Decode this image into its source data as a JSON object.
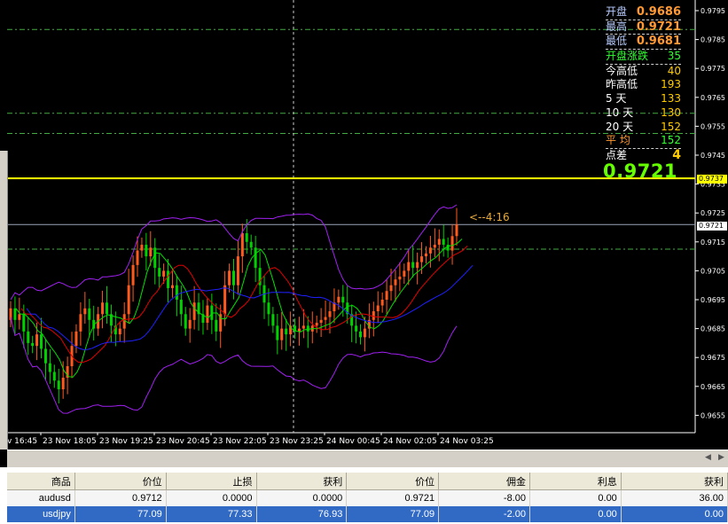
{
  "chart": {
    "price_axis": [
      "0.9795",
      "0.9785",
      "0.9775",
      "0.9765",
      "0.9755",
      "0.9745",
      "0.9735",
      "0.9725",
      "0.9715",
      "0.9705",
      "0.9695",
      "0.9685",
      "0.9675",
      "0.9665",
      "0.9655"
    ],
    "time_axis": [
      "23 Nov 16:45",
      "23 Nov 18:05",
      "23 Nov 19:25",
      "23 Nov 20:45",
      "23 Nov 22:05",
      "23 Nov 23:25",
      "24 Nov 00:45",
      "24 Nov 02:05",
      "24 Nov 03:25"
    ],
    "time_axis_first_visible": "v 16:45",
    "yellow_line_price": "0.9737",
    "current_price_tag": "0.9721",
    "countdown": "<--4:16",
    "big_price": "0.9721",
    "colors": {
      "up_candle": "#ff5a1e",
      "down_candle": "#00d200",
      "bollinger": "#a020f0",
      "ma_green": "#00e000",
      "ma_red": "#e00000",
      "ma_blue": "#2020ff",
      "grid_green": "#44aa44",
      "yellow": "#ffff00"
    }
  },
  "info_panel": [
    {
      "label": "开盘",
      "value": "0.9686",
      "label_color": "#b8ccff",
      "value_color": "#ff9933",
      "dashed": true
    },
    {
      "label": "最高",
      "value": "0.9721",
      "label_color": "#b8ccff",
      "value_color": "#ff9933",
      "dashed": true
    },
    {
      "label": "最低",
      "value": "0.9681",
      "label_color": "#b8ccff",
      "value_color": "#ff9933",
      "dashed": true
    },
    {
      "label": "开盘涨跌",
      "value": "35",
      "label_color": "#33ff33",
      "value_color": "#33ff33",
      "dashed": true
    },
    {
      "label": "今高低",
      "value": "40",
      "label_color": "#ffffff",
      "value_color": "#ffcc00",
      "dashed": false
    },
    {
      "label": "昨高低",
      "value": "193",
      "label_color": "#ffffff",
      "value_color": "#ffcc00",
      "dashed": false
    },
    {
      "label": "5  天",
      "value": "133",
      "label_color": "#ffffff",
      "value_color": "#ffcc00",
      "dashed": false
    },
    {
      "label": "10  天",
      "value": "130",
      "label_color": "#ffffff",
      "value_color": "#ffcc00",
      "dashed": false
    },
    {
      "label": "20  天",
      "value": "152",
      "label_color": "#ffffff",
      "value_color": "#ffcc00",
      "dashed": false
    },
    {
      "label": "平  均",
      "value": "152",
      "label_color": "#ff9933",
      "value_color": "#33ff33",
      "dashed": true
    },
    {
      "label": "点差",
      "value": "4",
      "label_color": "#ffffff",
      "value_color": "#ffcc00",
      "dashed": false
    }
  ],
  "terminal": {
    "headers": [
      "商品",
      "价位",
      "止损",
      "获利",
      "价位",
      "佣金",
      "利息",
      "获利"
    ],
    "rows": [
      {
        "symbol": "audusd",
        "price": "0.9712",
        "stop": "0.0000",
        "take": "0.0000",
        "current": "0.9721",
        "commission": "-8.00",
        "swap": "0.00",
        "profit": "36.00",
        "selected": false
      },
      {
        "symbol": "usdjpy",
        "price": "77.09",
        "stop": "77.33",
        "take": "76.93",
        "current": "77.09",
        "commission": "-2.00",
        "swap": "0.00",
        "profit": "0.00",
        "selected": true
      }
    ]
  }
}
